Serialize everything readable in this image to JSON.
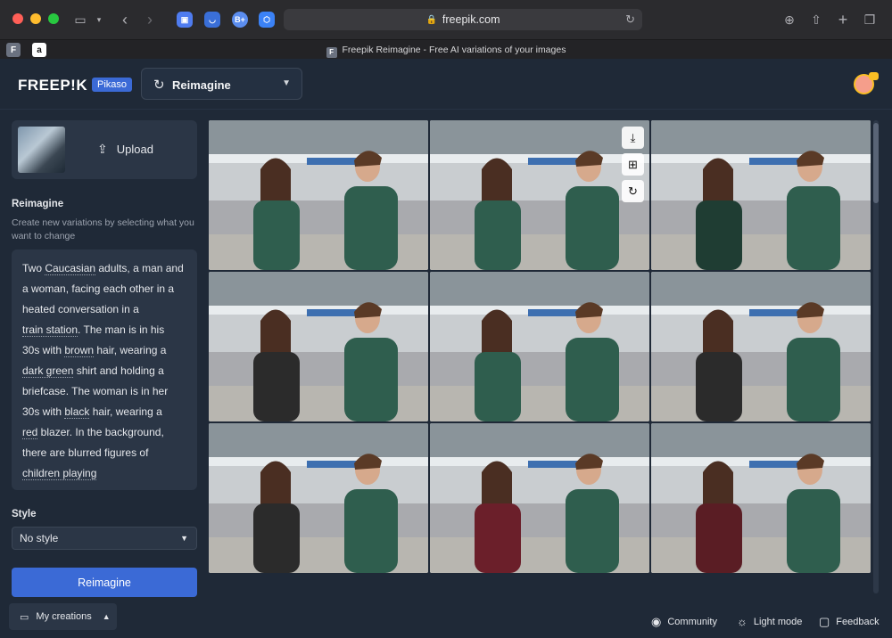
{
  "browser": {
    "url": "freepik.com",
    "tab_title": "Freepik Reimagine - Free AI variations of your images",
    "tab_favicon": "F",
    "pinned_tabs": [
      "F",
      "a"
    ],
    "extensions": [
      "photos",
      "pocket",
      "B+",
      "hex"
    ]
  },
  "header": {
    "logo": "FREEP!K",
    "badge": "Pikaso",
    "mode": "Reimagine"
  },
  "sidebar": {
    "upload_label": "Upload",
    "section_title": "Reimagine",
    "description": "Create new variations by selecting what you want to change",
    "prompt": {
      "l1a": "Two ",
      "l1b": "Caucasian",
      "l1c": " adults, a man and",
      "l2": "a woman, facing each other in a",
      "l3": "heated conversation in a",
      "l4a": "train station",
      "l4b": ". The man is in his",
      "l5a": "30s with ",
      "l5b": "brown",
      "l5c": " hair, wearing a",
      "l6a": "dark green",
      "l6b": " shirt and holding a",
      "l7": "briefcase. The woman is in her",
      "l8a": "30s with ",
      "l8b": "black",
      "l8c": " hair, wearing a",
      "l9a": "red",
      "l9b": " blazer. In the background,",
      "l10": "there are blurred figures of",
      "l11": "children playing"
    },
    "style_title": "Style",
    "style_value": "No style",
    "primary_button": "Reimagine",
    "my_creations": "My creations"
  },
  "gallery": {
    "tile_count": 9,
    "actions": [
      "download-icon",
      "add-to-folder-icon",
      "regenerate-icon"
    ]
  },
  "footer": {
    "community": "Community",
    "light_mode": "Light mode",
    "feedback": "Feedback"
  }
}
